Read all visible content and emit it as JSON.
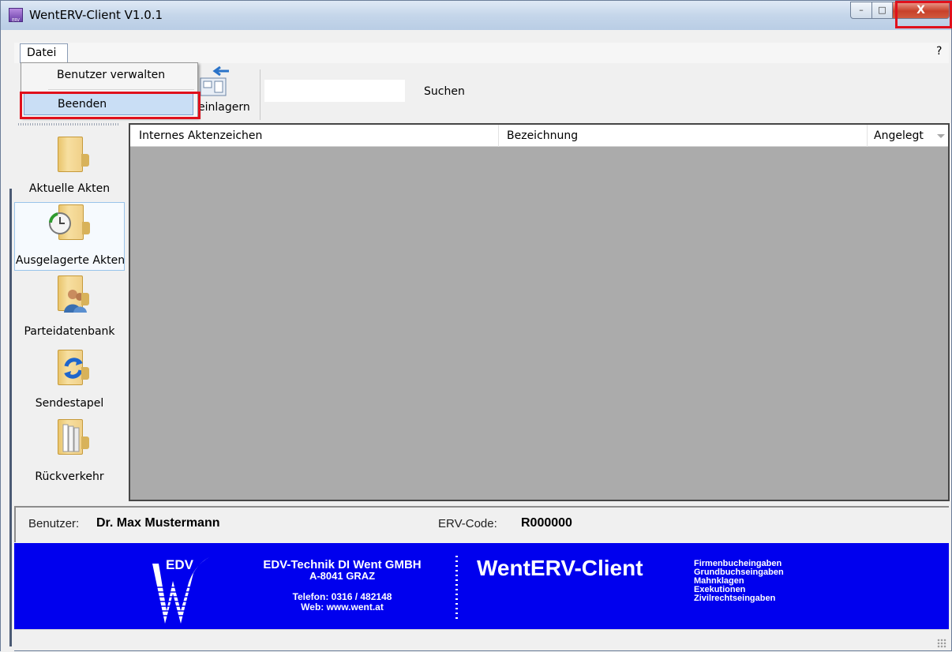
{
  "window": {
    "title": "WentERV-Client V1.0.1",
    "close_symbol": "X",
    "minimize_symbol": "–",
    "maximize_symbol": "□"
  },
  "menu": {
    "datei": "Datei",
    "help": "?",
    "dropdown": {
      "item1": "Benutzer verwalten",
      "item2": "Beenden"
    }
  },
  "toolbar": {
    "einlagern_label": "einlagern",
    "search_value": "",
    "search_label": "Suchen"
  },
  "nav": {
    "items": [
      {
        "label": "Aktuelle Akten",
        "icon": "folder-icon"
      },
      {
        "label": "Ausgelagerte Akten",
        "icon": "folder-clock-icon"
      },
      {
        "label": "Parteidatenbank",
        "icon": "folder-person-icon"
      },
      {
        "label": "Sendestapel",
        "icon": "folder-sync-icon"
      },
      {
        "label": "Rückverkehr",
        "icon": "folder-papers-icon"
      }
    ]
  },
  "table": {
    "columns": [
      "Internes Aktenzeichen",
      "Bezeichnung",
      "Angelegt"
    ]
  },
  "user": {
    "label": "Benutzer:",
    "name": "Dr. Max Mustermann",
    "erv_label": "ERV-Code:",
    "erv_code": "R000000"
  },
  "banner": {
    "logo_text": "EDV",
    "company": "EDV-Technik DI Went GMBH",
    "address": "A-8041 GRAZ",
    "phone": "Telefon: 0316 / 482148",
    "web": "Web: www.went.at",
    "brand": "WentERV-Client",
    "services": [
      "Firmenbucheingaben",
      "Grundbuchseingaben",
      "Mahnklagen",
      "Exekutionen",
      "Zivilrechtseingaben"
    ]
  },
  "colors": {
    "banner": "#0000ee",
    "highlight": "#e0101c",
    "grid_bg": "#ababab"
  }
}
